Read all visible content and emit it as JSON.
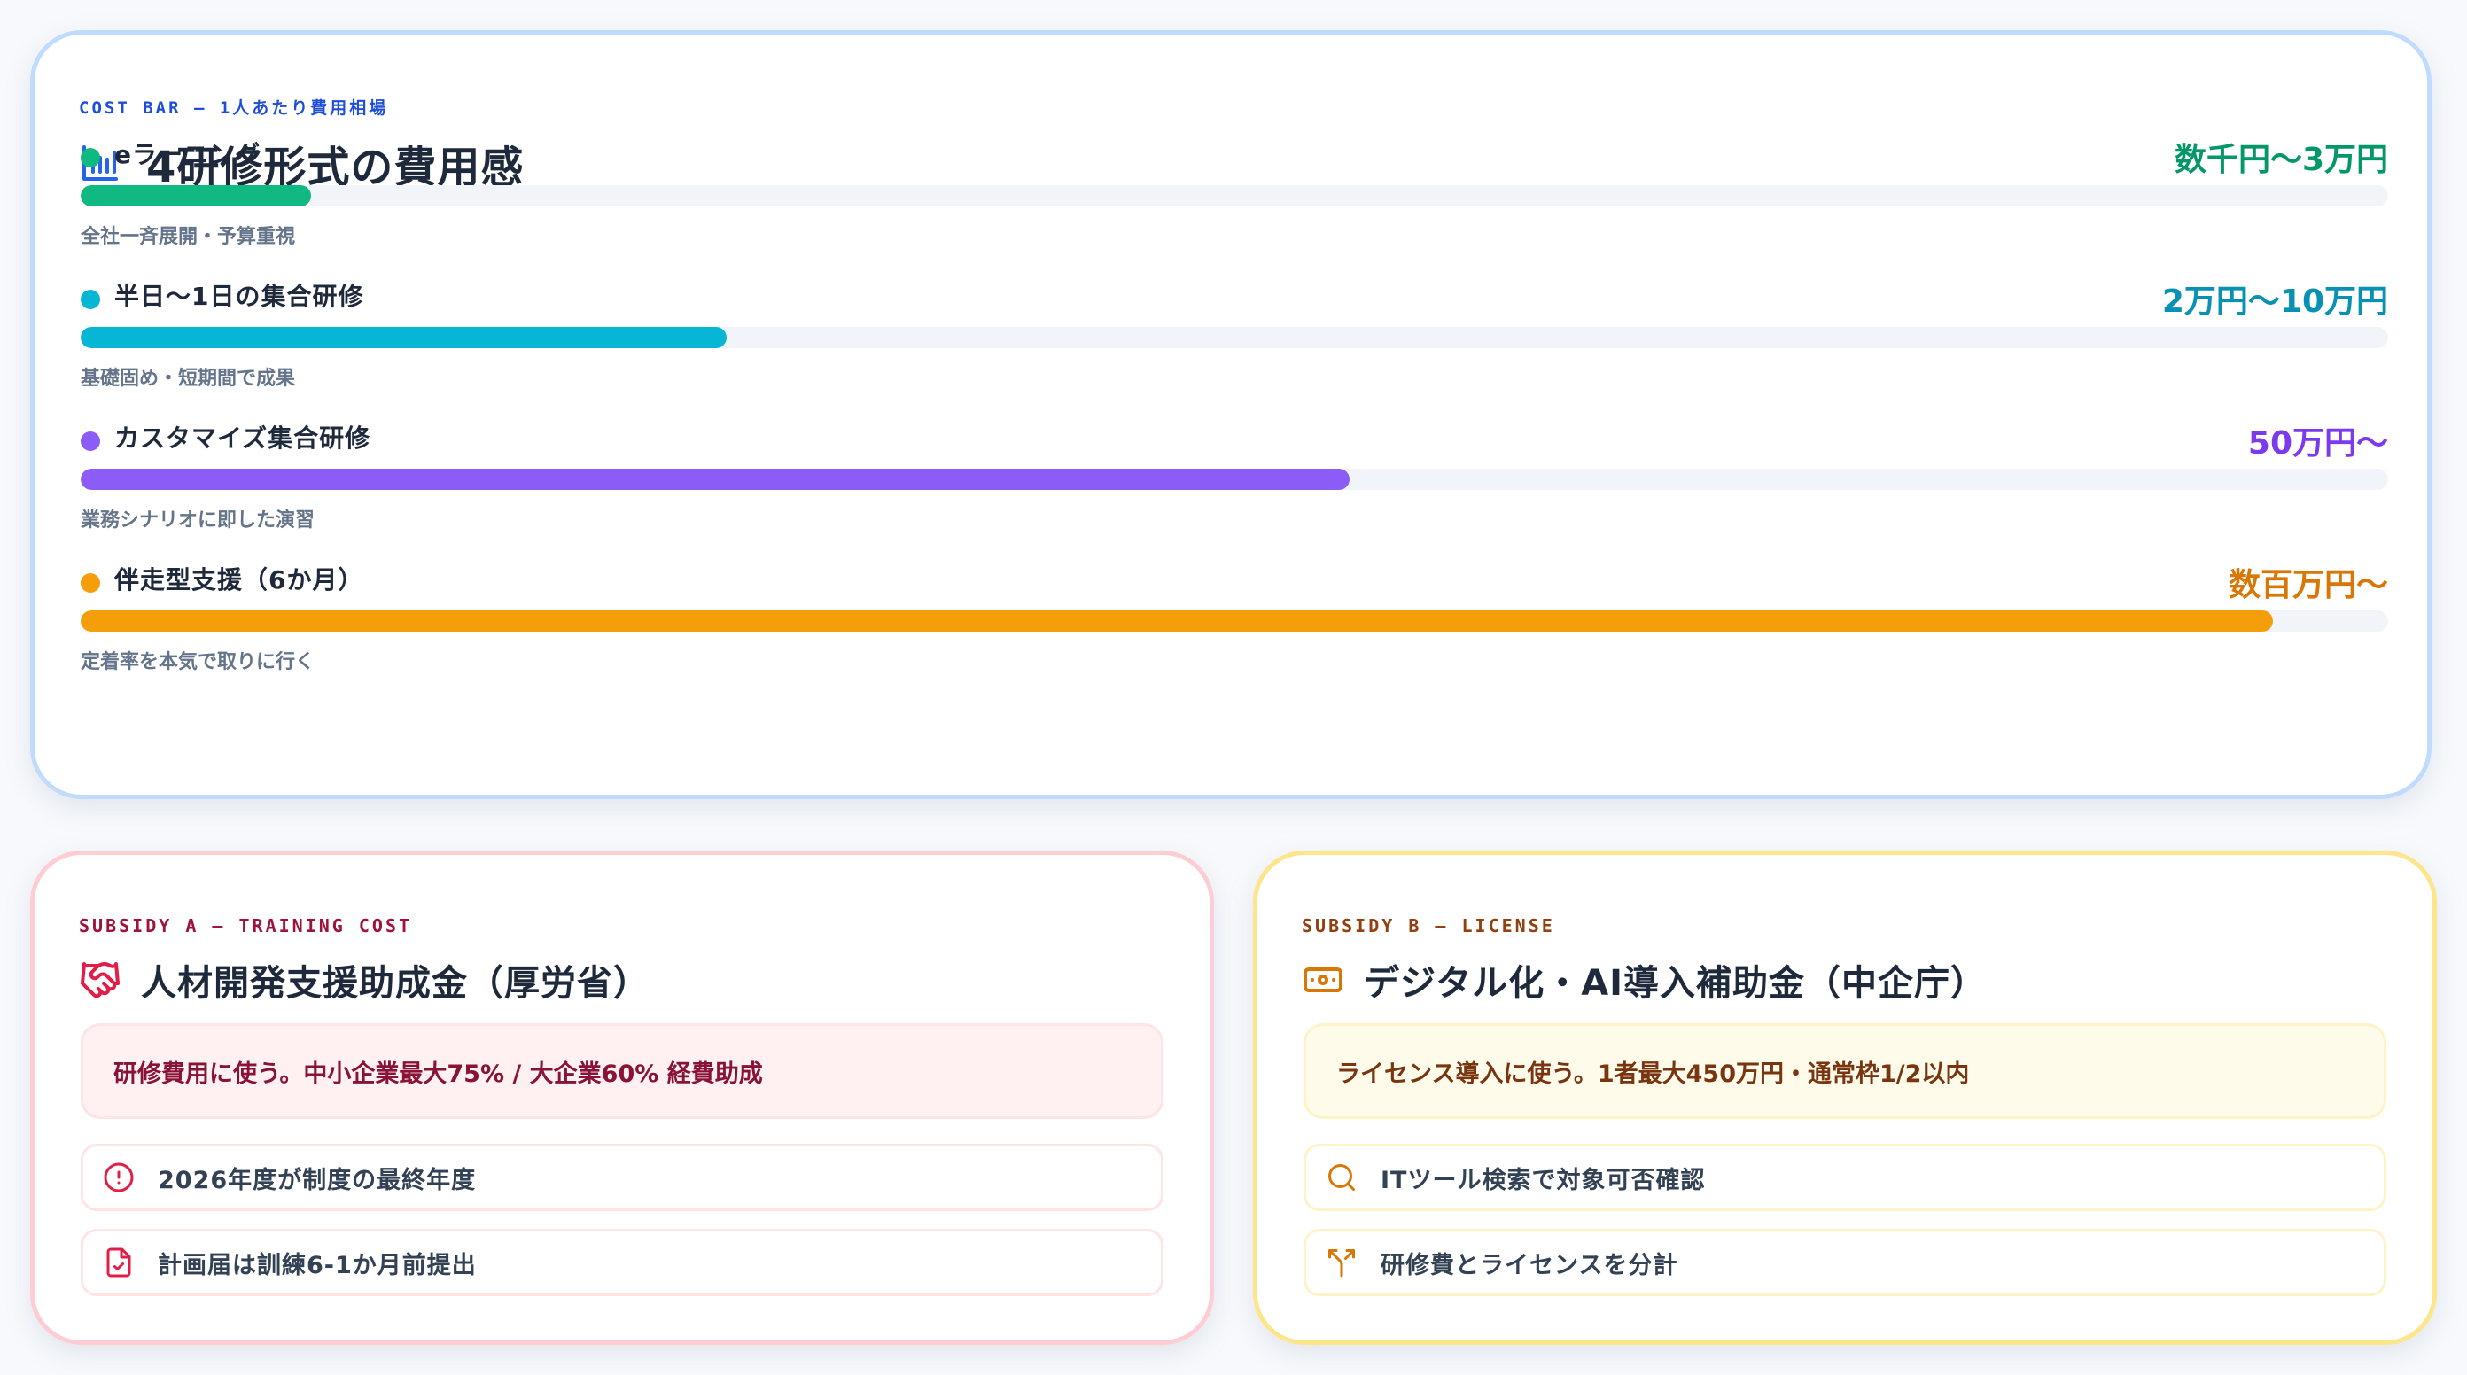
{
  "cost_bar": {
    "eyebrow": "COST BAR — 1人あたり費用相場",
    "title": "4研修形式の費用感",
    "title_icon": "bar-chart-icon",
    "items": [
      {
        "name": "eラーニング",
        "price": "数千円〜3万円",
        "note": "全社一斉展開・予算重視",
        "color": "#10b981",
        "price_color": "#059669",
        "level": 0.1
      },
      {
        "name": "半日〜1日の集合研修",
        "price": "2万円〜10万円",
        "note": "基礎固め・短期間で成果",
        "color": "#06b6d4",
        "price_color": "#0891b2",
        "level": 0.28
      },
      {
        "name": "カスタマイズ集合研修",
        "price": "50万円〜",
        "note": "業務シナリオに即した演習",
        "color": "#8b5cf6",
        "price_color": "#7c3aed",
        "level": 0.55
      },
      {
        "name": "伴走型支援（6か月）",
        "price": "数百万円〜",
        "note": "定着率を本気で取りに行く",
        "color": "#f59e0b",
        "price_color": "#d97706",
        "level": 0.95
      }
    ]
  },
  "subsidy_a": {
    "eyebrow": "SUBSIDY A — TRAINING COST",
    "title": "人材開発支援助成金（厚労省）",
    "title_icon": "handshake-icon",
    "highlight": "研修費用に使う。中小企業最大75% / 大企業60% 経費助成",
    "accent": "#e11d48",
    "items": [
      {
        "icon": "alert-circle-icon",
        "text": "2026年度が制度の最終年度"
      },
      {
        "icon": "file-check-icon",
        "text": "計画届は訓練6-1か月前提出"
      }
    ]
  },
  "subsidy_b": {
    "eyebrow": "SUBSIDY B — LICENSE",
    "title": "デジタル化・AI導入補助金（中企庁）",
    "title_icon": "banknote-icon",
    "highlight": "ライセンス導入に使う。1者最大450万円・通常枠1/2以内",
    "accent": "#d97706",
    "items": [
      {
        "icon": "search-icon",
        "text": "ITツール検索で対象可否確認"
      },
      {
        "icon": "split-icon",
        "text": "研修費とライセンスを分計"
      }
    ]
  }
}
